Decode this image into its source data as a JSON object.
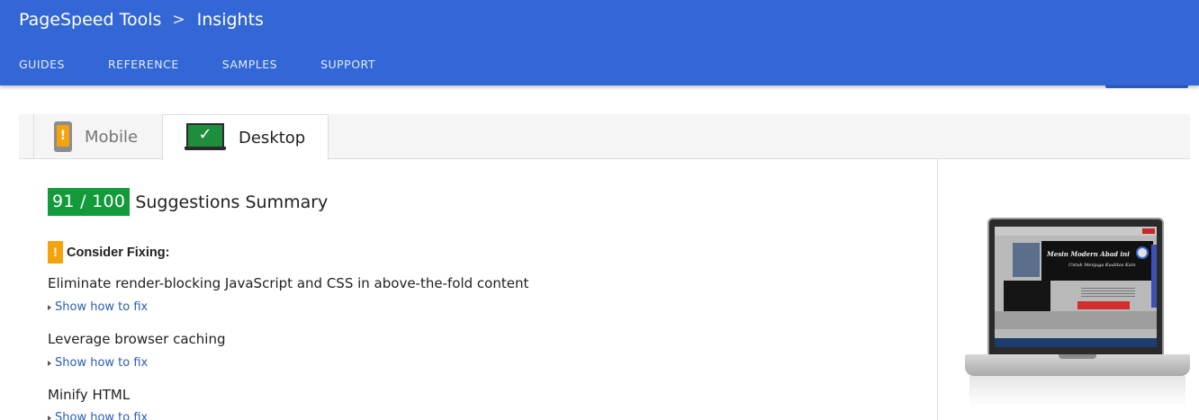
{
  "header": {
    "breadcrumb": [
      "PageSpeed Tools",
      "Insights"
    ],
    "separator": ">",
    "nav": [
      "GUIDES",
      "REFERENCE",
      "SAMPLES",
      "SUPPORT"
    ],
    "color": "#3367d6"
  },
  "tabs": [
    {
      "label": "Mobile",
      "icon": "mobile-phone-warning-icon",
      "selected": false
    },
    {
      "label": "Desktop",
      "icon": "desktop-monitor-check-icon",
      "selected": true
    }
  ],
  "summary": {
    "score": "91 / 100",
    "title": "Suggestions Summary",
    "score_color": "#129a3b"
  },
  "consider": {
    "label": "Consider Fixing:",
    "icon": "warning-icon",
    "color": "#f4a30d"
  },
  "rules": [
    {
      "title": "Eliminate render-blocking JavaScript and CSS in above-the-fold content",
      "link": "Show how to fix"
    },
    {
      "title": "Leverage browser caching",
      "link": "Show how to fix"
    },
    {
      "title": "Minify HTML",
      "link": "Show how to fix"
    }
  ],
  "preview": {
    "banner_line1": "Mesin Modern Abad ini",
    "banner_line2": "Untuk Menjaga Kualitas Kain"
  }
}
